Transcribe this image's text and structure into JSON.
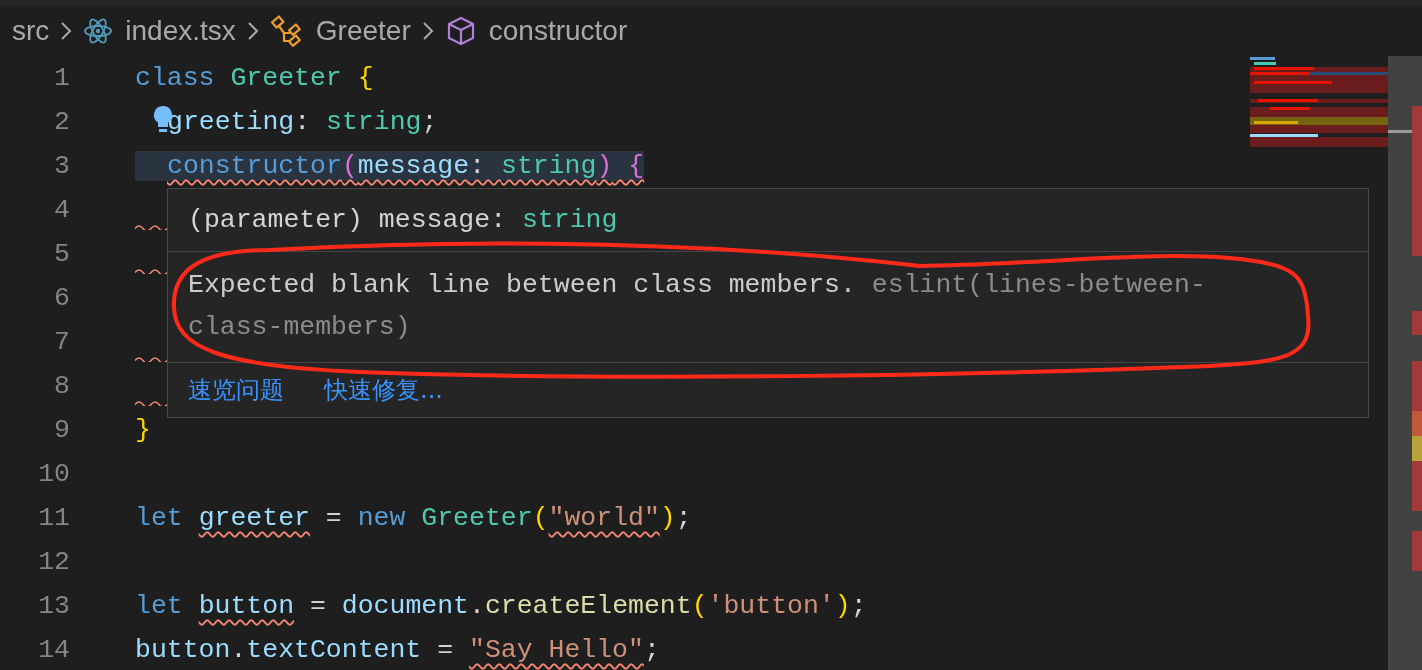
{
  "breadcrumb": [
    "src",
    "index.tsx",
    "Greeter",
    "constructor"
  ],
  "lines": [
    {
      "kind": "code",
      "number": "1",
      "highlighted": false,
      "tokens": [
        {
          "text": "class ",
          "kind": "keyword",
          "error": false
        },
        {
          "text": "Greeter ",
          "kind": "type",
          "error": false
        },
        {
          "text": "{",
          "kind": "bracket",
          "error": false
        }
      ],
      "children": [
        {
          "kind": "code",
          "number": "2",
          "highlighted": false,
          "tokens": [
            {
              "text": "greeting",
              "kind": "variable",
              "error": false
            },
            {
              "text": ": ",
              "kind": "plain",
              "error": false
            },
            {
              "text": "string",
              "kind": "type",
              "error": false
            },
            {
              "text": ";",
              "kind": "plain",
              "error": false
            }
          ]
        },
        {
          "kind": "code",
          "number": "3",
          "highlighted": true,
          "tokens": [
            {
              "text": "constructor",
              "kind": "keyword",
              "error": true
            },
            {
              "text": "(",
              "kind": "bracket2",
              "error": true
            },
            {
              "text": "message",
              "kind": "variable",
              "error": true
            },
            {
              "text": ": ",
              "kind": "plain",
              "error": true
            },
            {
              "text": "string",
              "kind": "type",
              "error": true
            },
            {
              "text": ")",
              "kind": "bracket2",
              "error": true
            },
            {
              "text": " {",
              "kind": "bracket2",
              "error": true
            }
          ]
        }
      ]
    },
    {
      "kind": "covered",
      "number": "4",
      "error": true
    },
    {
      "kind": "covered",
      "number": "5",
      "error": true
    },
    {
      "kind": "covered",
      "number": "6",
      "error": false
    },
    {
      "kind": "covered",
      "number": "7",
      "error": true
    },
    {
      "kind": "covered",
      "number": "8",
      "error": true
    },
    {
      "kind": "code",
      "number": "9",
      "highlighted": false,
      "tokens": [
        {
          "text": "}",
          "kind": "bracket",
          "error": false
        }
      ]
    },
    {
      "kind": "blank",
      "number": "10"
    },
    {
      "kind": "code",
      "number": "11",
      "highlighted": false,
      "tokens": [
        {
          "text": "let ",
          "kind": "keyword",
          "error": false
        },
        {
          "text": "greeter",
          "kind": "variable",
          "error": true
        },
        {
          "text": " = ",
          "kind": "plain",
          "error": false
        },
        {
          "text": "new ",
          "kind": "keyword",
          "error": false
        },
        {
          "text": "Greeter",
          "kind": "type",
          "error": false
        },
        {
          "text": "(",
          "kind": "bracket",
          "error": false
        },
        {
          "text": "\"world\"",
          "kind": "string",
          "error": true
        },
        {
          "text": ")",
          "kind": "bracket",
          "error": false
        },
        {
          "text": ";",
          "kind": "plain",
          "error": false
        }
      ]
    },
    {
      "kind": "blank",
      "number": "12"
    },
    {
      "kind": "code",
      "number": "13",
      "highlighted": false,
      "tokens": [
        {
          "text": "let ",
          "kind": "keyword",
          "error": false
        },
        {
          "text": "button",
          "kind": "variable",
          "error": true
        },
        {
          "text": " = ",
          "kind": "plain",
          "error": false
        },
        {
          "text": "document",
          "kind": "variable",
          "error": false
        },
        {
          "text": ".",
          "kind": "plain",
          "error": false
        },
        {
          "text": "createElement",
          "kind": "function",
          "error": false
        },
        {
          "text": "(",
          "kind": "bracket",
          "error": false
        },
        {
          "text": "'button'",
          "kind": "string",
          "error": false
        },
        {
          "text": ")",
          "kind": "bracket",
          "error": false
        },
        {
          "text": ";",
          "kind": "plain",
          "error": false
        }
      ]
    },
    {
      "kind": "code",
      "number": "14",
      "highlighted": false,
      "tokens": [
        {
          "text": "button",
          "kind": "variable",
          "error": false
        },
        {
          "text": ".",
          "kind": "plain",
          "error": false
        },
        {
          "text": "textContent",
          "kind": "variable",
          "error": false
        },
        {
          "text": " = ",
          "kind": "plain",
          "error": false
        },
        {
          "text": "\"Say Hello\"",
          "kind": "string",
          "error": true
        },
        {
          "text": ";",
          "kind": "plain",
          "error": false
        }
      ]
    }
  ],
  "hover": {
    "signature": [
      {
        "text": "(parameter) message: ",
        "kind": "plain"
      },
      {
        "text": "string",
        "kind": "type"
      }
    ],
    "message": "Expected blank line between class members.",
    "source": "eslint(lines-between-class-members)",
    "actions": [
      "速览问题",
      "快速修复..."
    ]
  }
}
